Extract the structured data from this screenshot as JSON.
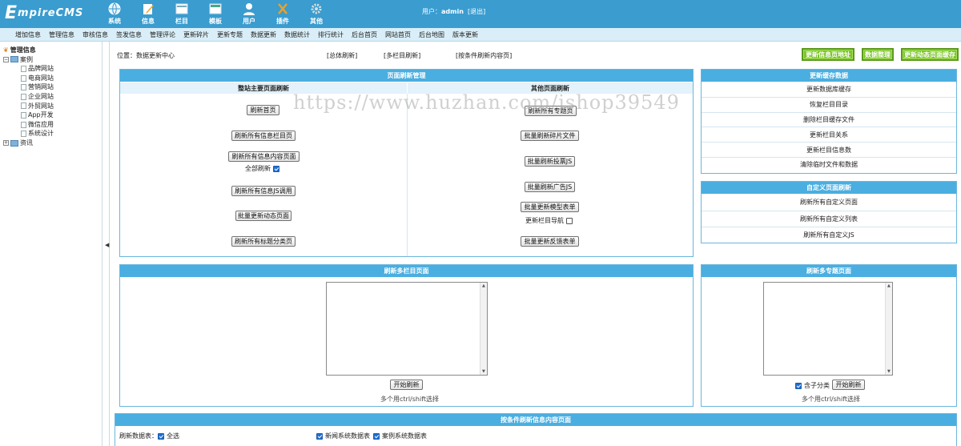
{
  "app": {
    "logo_big": "E",
    "logo_rest": "mpireCMS",
    "user_label": "用户：",
    "username": "admin",
    "logout": "[退出]"
  },
  "top_nav": [
    {
      "label": "系统",
      "icon": "globe-icon"
    },
    {
      "label": "信息",
      "icon": "pencil-icon"
    },
    {
      "label": "栏目",
      "icon": "columns-icon"
    },
    {
      "label": "模板",
      "icon": "template-icon"
    },
    {
      "label": "用户",
      "icon": "user-icon"
    },
    {
      "label": "插件",
      "icon": "plugin-icon"
    },
    {
      "label": "其他",
      "icon": "gear-icon"
    }
  ],
  "menu": [
    "增加信息",
    "管理信息",
    "审核信息",
    "签发信息",
    "管理评论",
    "更新碎片",
    "更新专题",
    "数据更新",
    "数据统计",
    "排行统计",
    "后台首页",
    "网站首页",
    "后台地图",
    "版本更新"
  ],
  "tree": {
    "root": "管理信息",
    "case_folder": "案例",
    "case_items": [
      "品牌网站",
      "电商网站",
      "营销网站",
      "企业网站",
      "外贸网站",
      "App开发",
      "微信应用",
      "系统设计"
    ],
    "news_folder": "资讯"
  },
  "location": {
    "label": "位置：",
    "text": "数据更新中心",
    "links": [
      "[总体刷新]",
      "[多栏目刷新]",
      "[按条件刷新内容页]"
    ]
  },
  "top_buttons": [
    "更新信息页地址",
    "数据整理",
    "更新动态页面缓存"
  ],
  "page_refresh": {
    "title": "页面刷新管理",
    "left_title": "整站主要页面刷新",
    "right_title": "其他页面刷新",
    "left_buttons": [
      "刷新首页",
      "刷新所有信息栏目页",
      "刷新所有信息内容页面",
      "刷新所有信息JS调用",
      "批量更新动态页面",
      "刷新所有标题分类页"
    ],
    "full_refresh_label": "全部刷新",
    "right_buttons": [
      "刷新所有专题页",
      "批量刷新碎片文件",
      "批量刷新投票JS",
      "批量刷新广告JS",
      "批量更新模型表单",
      "批量更新反馈表单"
    ],
    "update_nav_label": "更新栏目导航"
  },
  "cache": {
    "title": "更新缓存数据",
    "items": [
      "更新数据库缓存",
      "恢复栏目目录",
      "删除栏目缓存文件",
      "更新栏目关系",
      "更新栏目信息数",
      "清除临时文件和数据"
    ]
  },
  "custom": {
    "title": "自定义页面刷新",
    "items": [
      "刷新所有自定义页面",
      "刷新所有自定义列表",
      "刷新所有自定义JS"
    ]
  },
  "multi_column": {
    "title": "刷新多栏目页面",
    "start": "开始刷新",
    "hint": "多个用ctrl/shift选择"
  },
  "multi_topic": {
    "title": "刷新多专题页面",
    "include_sub": "含子分类",
    "start": "开始刷新",
    "hint": "多个用ctrl/shift选择"
  },
  "by_condition": {
    "title": "按条件刷新信息内容页面",
    "table_label": "刷新数据表：",
    "select_all": "全选",
    "tables": [
      "新闻系统数据表",
      "案例系统数据表"
    ]
  },
  "watermark": "https://www.huzhan.com/ishop39549",
  "colors": {
    "header": "#3a9ccf",
    "panel_header": "#4aaee0",
    "green_button": "#7cc42c"
  }
}
